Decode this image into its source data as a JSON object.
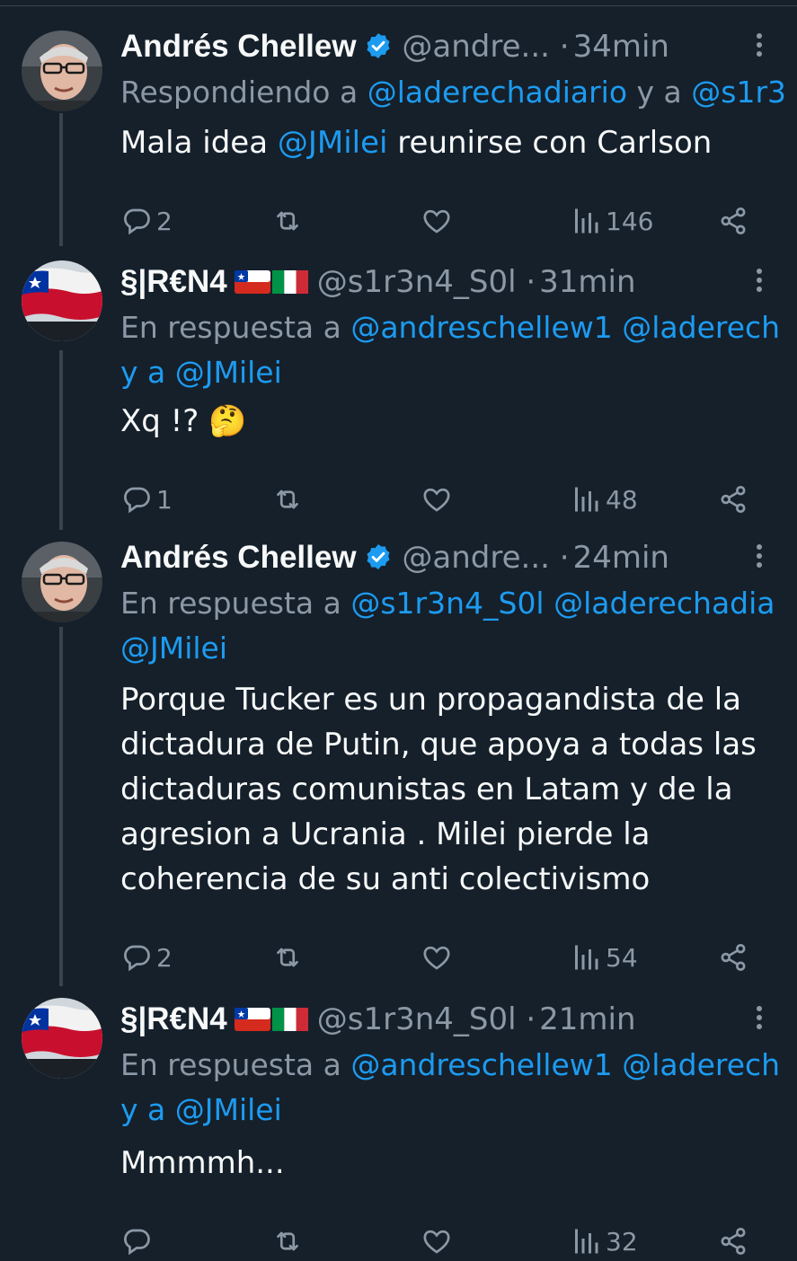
{
  "colors": {
    "background": "#15202b",
    "text": "#f7f9f9",
    "muted": "#8b98a5",
    "link": "#1d9bf0"
  },
  "tweets": [
    {
      "author": "Andrés Chellew",
      "verified": true,
      "handle": "@andre...",
      "dot": "·",
      "time": "34min",
      "reply_prefix": "Respondiendo a",
      "reply_lines": [
        [
          {
            "t": "@laderechadiario",
            "m": true
          },
          {
            "t": " y a ",
            "m": false
          },
          {
            "t": "@s1r3",
            "m": true
          }
        ]
      ],
      "body_lines": [
        [
          {
            "t": "Mala idea ",
            "m": false
          },
          {
            "t": "@JMilei",
            "m": true
          },
          {
            "t": " reunirse con Carlson",
            "m": false
          }
        ]
      ],
      "replies": "2",
      "views": "146"
    },
    {
      "author": "§|R€N4",
      "verified": false,
      "flags": [
        "chile-flag-icon",
        "italy-flag-icon"
      ],
      "handle": "@s1r3n4_S0l",
      "dot": "·",
      "time": "31min",
      "reply_prefix": "En respuesta a",
      "reply_lines": [
        [
          {
            "t": "@andreschellew1",
            "m": true
          },
          {
            "t": " ",
            "m": false
          },
          {
            "t": "@laderech",
            "m": true
          }
        ],
        [
          {
            "t": "y a ",
            "m": true
          },
          {
            "t": "@JMilei",
            "m": true
          }
        ]
      ],
      "body_lines": [
        [
          {
            "t": "Xq !? 🤔",
            "m": false
          }
        ]
      ],
      "replies": "1",
      "views": "48"
    },
    {
      "author": "Andrés Chellew",
      "verified": true,
      "handle": "@andre...",
      "dot": "·",
      "time": "24min",
      "reply_prefix": "En respuesta a",
      "reply_lines": [
        [
          {
            "t": "@s1r3n4_S0l",
            "m": true
          },
          {
            "t": " ",
            "m": false
          },
          {
            "t": "@laderechadia",
            "m": true
          }
        ],
        [
          {
            "t": "@JMilei",
            "m": true
          }
        ]
      ],
      "body_lines": [
        [
          {
            "t": "Porque Tucker es un propagandista de la",
            "m": false
          }
        ],
        [
          {
            "t": "dictadura de Putin, que apoya a todas las",
            "m": false
          }
        ],
        [
          {
            "t": "dictaduras comunistas en Latam y de la",
            "m": false
          }
        ],
        [
          {
            "t": "agresion a Ucrania . Milei pierde  la",
            "m": false
          }
        ],
        [
          {
            "t": "coherencia de su anti colectivismo",
            "m": false
          }
        ]
      ],
      "replies": "2",
      "views": "54"
    },
    {
      "author": "§|R€N4",
      "verified": false,
      "flags": [
        "chile-flag-icon",
        "italy-flag-icon"
      ],
      "handle": "@s1r3n4_S0l",
      "dot": "·",
      "time": "21min",
      "reply_prefix": "En respuesta a",
      "reply_lines": [
        [
          {
            "t": "@andreschellew1",
            "m": true
          },
          {
            "t": " ",
            "m": false
          },
          {
            "t": "@laderech",
            "m": true
          }
        ],
        [
          {
            "t": "y a ",
            "m": true
          },
          {
            "t": "@JMilei",
            "m": true
          }
        ]
      ],
      "body_lines": [
        [
          {
            "t": "Mmmmh...",
            "m": false
          }
        ]
      ],
      "replies": "",
      "views": "32"
    }
  ],
  "icons": {
    "reply": "reply-icon",
    "retweet": "retweet-icon",
    "like": "like-icon",
    "views": "views-icon",
    "share": "share-icon",
    "more": "more-icon",
    "verified": "verified-badge-icon"
  }
}
